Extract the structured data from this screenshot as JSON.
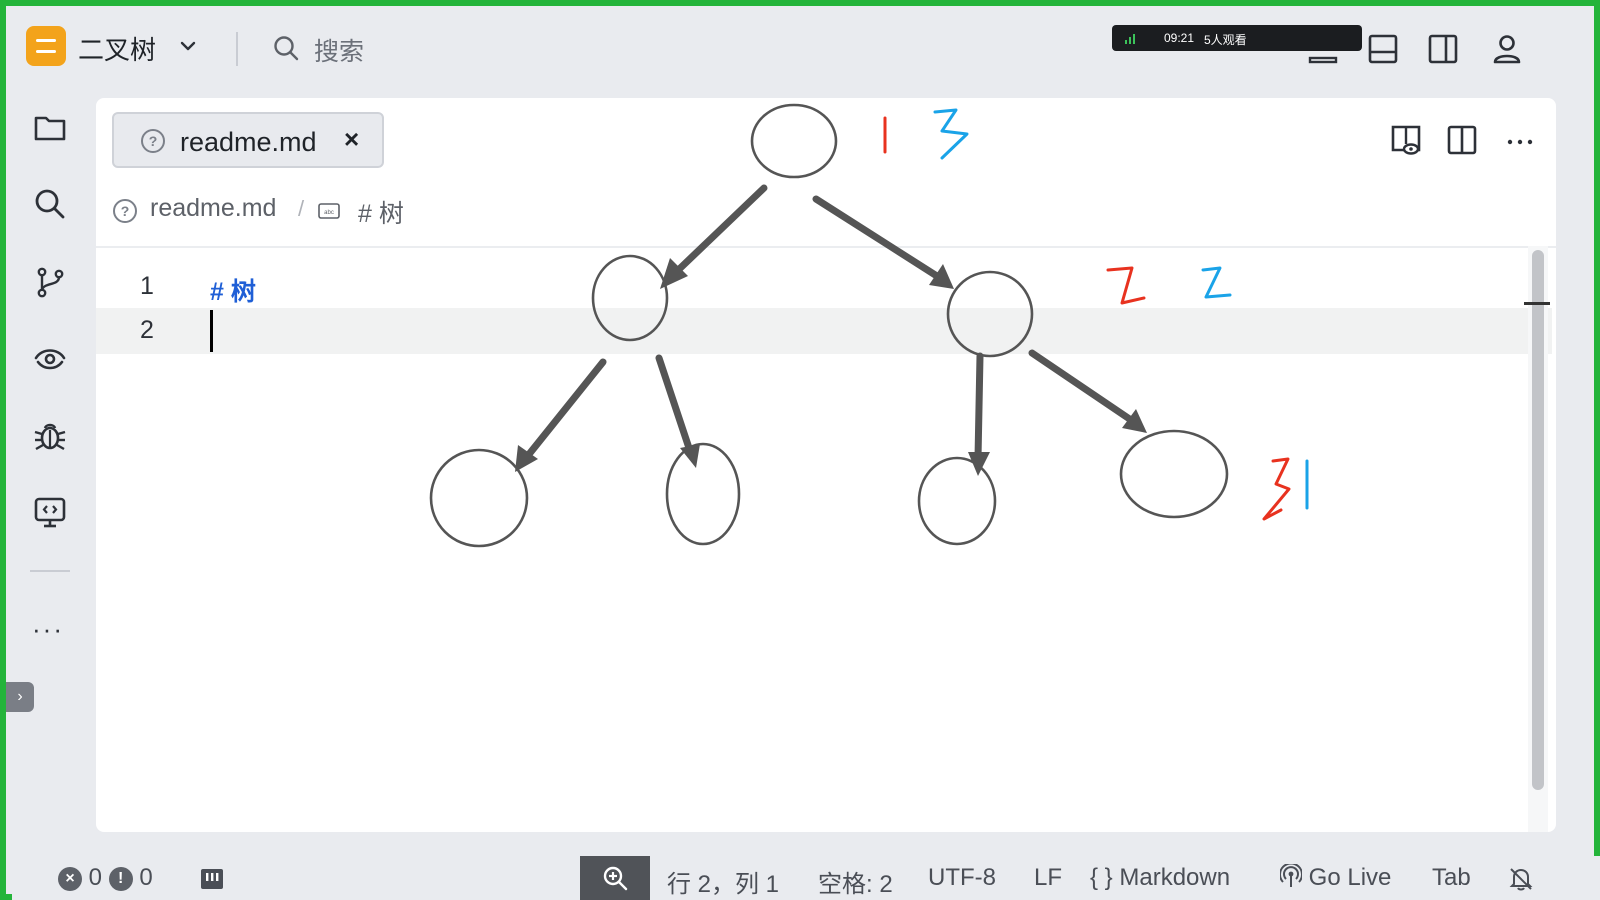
{
  "app": {
    "project_name": "二叉树",
    "search_label": "搜索",
    "brand_color": "#f3a31b",
    "frame_color": "#24b43a"
  },
  "live": {
    "time": "09:21",
    "viewers": "5人观看"
  },
  "activity_bar": {
    "items": [
      "folder-icon",
      "search-icon",
      "source-control-icon",
      "eye-icon",
      "debug-bug-icon",
      "remote-explorer-icon"
    ],
    "more": "···"
  },
  "editor": {
    "tab": {
      "label": "readme.md",
      "close": "×"
    },
    "breadcrumb": {
      "file": "readme.md",
      "separator": "/",
      "heading": "# 树"
    },
    "gutter": [
      "1",
      "2"
    ],
    "lines": [
      "#  树",
      ""
    ],
    "heading_color": "#1f5fd6"
  },
  "annotations": {
    "root_red": "1",
    "root_blue": "3",
    "level2_red": "2",
    "level2_blue": "2",
    "level3_red": "3",
    "level3_blue": "1",
    "red_color": "#e8321f",
    "blue_color": "#1aa3e8"
  },
  "statusbar": {
    "errors": "0",
    "warnings": "0",
    "position": "行 2，列 1",
    "spaces": "空格: 2",
    "encoding": "UTF-8",
    "eol": "LF",
    "language": "Markdown",
    "language_icon": "{ }",
    "go_live": "Go Live",
    "tab": "Tab"
  }
}
